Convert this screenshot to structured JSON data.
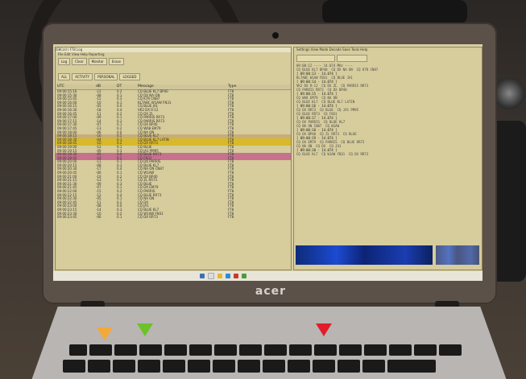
{
  "laptop": {
    "brand": "acer"
  },
  "left_window": {
    "title": "JS8Call / FT8 Log",
    "menu": "File  Edit  View  Help  Reporting",
    "buttons": [
      "Log",
      "Clear",
      "Monitor",
      "Erase"
    ],
    "columns": [
      "UTC",
      "dB",
      "DT",
      "Message",
      "Type"
    ],
    "tabs": [
      "ALL",
      "ACTIVITY",
      "PERSONAL",
      "LOGGED"
    ],
    "rows": [
      {
        "utc": "09:00:15:16",
        "db": "-12",
        "dt": "0.2",
        "msg": "CQ BLUE KL7 BP40",
        "type": "FT8",
        "cls": ""
      },
      {
        "utc": "09:00:15:30",
        "db": "-08",
        "dt": "0.1",
        "msg": "CQ DX NA ON",
        "type": "FT8",
        "cls": ""
      },
      {
        "utc": "09:00:15:45",
        "db": "-15",
        "dt": "0.3",
        "msg": "CQ K7R CN87",
        "type": "FT8",
        "cls": ""
      },
      {
        "utc": "09:00:16:00",
        "db": "-10",
        "dt": "0.1",
        "msg": "KL7ABC W1AW FN31",
        "type": "FT8",
        "cls": ""
      },
      {
        "utc": "09:00:16:15",
        "db": "-05",
        "dt": "0.0",
        "msg": "CQ BLUE JA1",
        "type": "FT8",
        "cls": ""
      },
      {
        "utc": "09:00:16:30",
        "db": "-18",
        "dt": "0.4",
        "msg": "VK2 DX R-12",
        "type": "FT8",
        "cls": ""
      },
      {
        "utc": "09:00:16:45",
        "db": "-11",
        "dt": "0.2",
        "msg": "CQ DX ZL",
        "type": "FT8",
        "cls": ""
      },
      {
        "utc": "09:00:17:00",
        "db": "-09",
        "dt": "0.1",
        "msg": "CQ PARRIS RR73",
        "type": "FT8",
        "cls": ""
      },
      {
        "utc": "09:00:17:15",
        "db": "-14",
        "dt": "0.3",
        "msg": "CQ PARRIS RR73",
        "type": "FT8",
        "cls": ""
      },
      {
        "utc": "09:00:17:30",
        "db": "-07",
        "dt": "0.1",
        "msg": "CQ DX BP40",
        "type": "FT8",
        "cls": ""
      },
      {
        "utc": "09:00:17:45",
        "db": "-13",
        "dt": "0.2",
        "msg": "CQ WA8 EM79",
        "type": "FT8",
        "cls": ""
      },
      {
        "utc": "09:00:18:00",
        "db": "-06",
        "dt": "0.0",
        "msg": "CQ NA ON",
        "type": "FT8",
        "cls": ""
      },
      {
        "utc": "09:00:18:15",
        "db": "-16",
        "dt": "0.5",
        "msg": "CQ BLUE KL7",
        "type": "FT8",
        "cls": "hl-tan"
      },
      {
        "utc": "09:00:18:30",
        "db": "-04",
        "dt": "0.1",
        "msg": "CQ BLUE KL7 LATIN",
        "type": "FT8",
        "cls": "hl-yellow"
      },
      {
        "utc": "09:00:18:45",
        "db": "-10",
        "dt": "0.2",
        "msg": "CQ DX RR73",
        "type": "FT8",
        "cls": "hl-yellow"
      },
      {
        "utc": "09:00:19:00",
        "db": "-12",
        "dt": "0.1",
        "msg": "CQ BLUE",
        "type": "FT8",
        "cls": ""
      },
      {
        "utc": "09:00:19:15",
        "db": "-09",
        "dt": "0.3",
        "msg": "CQ JA1 PM95",
        "type": "FT8",
        "cls": ""
      },
      {
        "utc": "09:00:19:30",
        "db": "-05",
        "dt": "0.0",
        "msg": "CQ BLUE RR73",
        "type": "FT8",
        "cls": "hl-pink"
      },
      {
        "utc": "09:00:19:45",
        "db": "-14",
        "dt": "0.2",
        "msg": "CQ FN31",
        "type": "FT8",
        "cls": "hl-pink"
      },
      {
        "utc": "09:00:20:00",
        "db": "-11",
        "dt": "0.1",
        "msg": "CQ DX PARRIS",
        "type": "FT8",
        "cls": ""
      },
      {
        "utc": "09:00:20:15",
        "db": "-08",
        "dt": "0.3",
        "msg": "CQ BLUE KL7",
        "type": "FT8",
        "cls": ""
      },
      {
        "utc": "09:00:20:30",
        "db": "-17",
        "dt": "0.4",
        "msg": "CQ NA ON CN87",
        "type": "FT8",
        "cls": ""
      },
      {
        "utc": "09:00:20:45",
        "db": "-06",
        "dt": "0.1",
        "msg": "CQ W1AW",
        "type": "FT8",
        "cls": ""
      },
      {
        "utc": "09:00:21:00",
        "db": "-10",
        "dt": "0.2",
        "msg": "CQ DX BP40",
        "type": "FT8",
        "cls": ""
      },
      {
        "utc": "09:00:21:15",
        "db": "-13",
        "dt": "0.1",
        "msg": "CQ ZL RR73",
        "type": "FT8",
        "cls": ""
      },
      {
        "utc": "09:00:21:30",
        "db": "-09",
        "dt": "0.3",
        "msg": "CQ BLUE",
        "type": "FT8",
        "cls": ""
      },
      {
        "utc": "09:00:21:45",
        "db": "-07",
        "dt": "0.1",
        "msg": "CQ DX EM79",
        "type": "FT8",
        "cls": ""
      },
      {
        "utc": "09:00:22:00",
        "db": "-15",
        "dt": "0.2",
        "msg": "CQ PARRIS",
        "type": "FT8",
        "cls": ""
      },
      {
        "utc": "09:00:22:15",
        "db": "-12",
        "dt": "0.4",
        "msg": "CQ BLUE RR73",
        "type": "FT8",
        "cls": ""
      },
      {
        "utc": "09:00:22:30",
        "db": "-05",
        "dt": "0.1",
        "msg": "CQ NA ON",
        "type": "FT8",
        "cls": ""
      },
      {
        "utc": "09:00:22:45",
        "db": "-11",
        "dt": "0.2",
        "msg": "CQ DX",
        "type": "FT8",
        "cls": ""
      },
      {
        "utc": "09:00:23:00",
        "db": "-08",
        "dt": "0.0",
        "msg": "CQ JA1",
        "type": "FT8",
        "cls": ""
      },
      {
        "utc": "09:00:23:15",
        "db": "-14",
        "dt": "0.3",
        "msg": "CQ BLUE KL7",
        "type": "FT8",
        "cls": ""
      },
      {
        "utc": "09:00:23:30",
        "db": "-10",
        "dt": "0.2",
        "msg": "CQ W1AW FN31",
        "type": "FT8",
        "cls": ""
      },
      {
        "utc": "09:00:23:45",
        "db": "-06",
        "dt": "0.1",
        "msg": "CQ DX RR73",
        "type": "FT8",
        "cls": ""
      }
    ]
  },
  "right_window": {
    "menu": "Settings  View  Mode  Decode  Save  Tools  Help",
    "lines": [
      "09:00:12 ---- 14.074 MHz ----",
      "CQ BLUE KL7 BP40  CQ DX NA ON  CQ K7R CN87",
      "",
      "[ 09:00:13 - 14.074 ]",
      "KL7ABC W1AW FN31  CQ BLUE JA1",
      "",
      "[ 09:00:14 - 14.074 ]",
      "VK2 DX R-12  CQ DX ZL  CQ PARRIS RR73",
      "CQ PARRIS RR73  CQ DX BP40",
      "",
      "[ 09:00:15 - 14.074 ]",
      "CQ WA8 EM79  CQ NA ON",
      "CQ BLUE KL7  CQ BLUE KL7 LATIN",
      "",
      "[ 09:00:16 - 14.074 ]",
      "CQ DX RR73  CQ BLUE  CQ JA1 PM95",
      "CQ BLUE RR73  CQ FN31",
      "",
      "[ 09:00:17 - 14.074 ]",
      "CQ DX PARRIS  CQ BLUE KL7",
      "CQ NA ON CN87  CQ W1AW",
      "",
      "[ 09:00:18 - 14.074 ]",
      "CQ DX BP40  CQ ZL RR73  CQ BLUE",
      "",
      "[ 09:00:19 - 14.074 ]",
      "CQ DX EM79  CQ PARRIS  CQ BLUE RR73",
      "CQ NA ON  CQ DX  CQ JA1",
      "",
      "[ 09:00:20 - 14.074 ]",
      "CQ BLUE KL7  CQ W1AW FN31  CQ DX RR73"
    ]
  },
  "colors": {
    "screen_bg": "#d9cfa3",
    "row_yellow": "#d7b92a",
    "row_pink": "#c7718e",
    "waterfall": "#1c4bd1"
  },
  "markers": [
    {
      "color": "#f4a83a"
    },
    {
      "color": "#6ec12a"
    },
    {
      "color": "#e21d2a"
    }
  ]
}
